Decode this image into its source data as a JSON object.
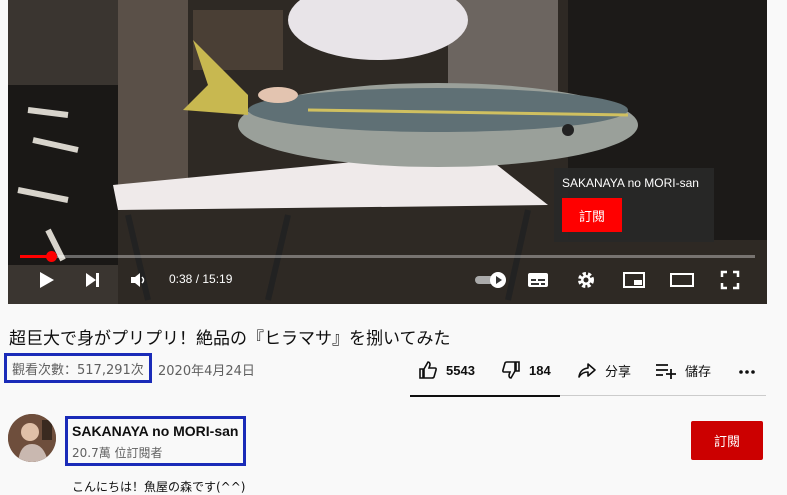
{
  "player": {
    "time": "0:38 / 15:19",
    "progress": 0.042,
    "endscreen": {
      "channel": "SAKANAYA no MORI-san",
      "subscribe_label": "訂閱"
    }
  },
  "video": {
    "title": "超巨大で身がプリプリ！絶品の『ヒラマサ』を捌いてみた",
    "views": "觀看次數：517,291次",
    "date": "2020年4月24日"
  },
  "actions": {
    "likes": "5543",
    "dislikes": "184",
    "share": "分享",
    "save": "儲存"
  },
  "channel": {
    "name": "SAKANAYA no MORI-san",
    "subscribers": "20.7萬 位訂閱者",
    "subscribe_label": "訂閱"
  },
  "description": {
    "first_line": "こんにちは！魚屋の森です(^^)"
  }
}
